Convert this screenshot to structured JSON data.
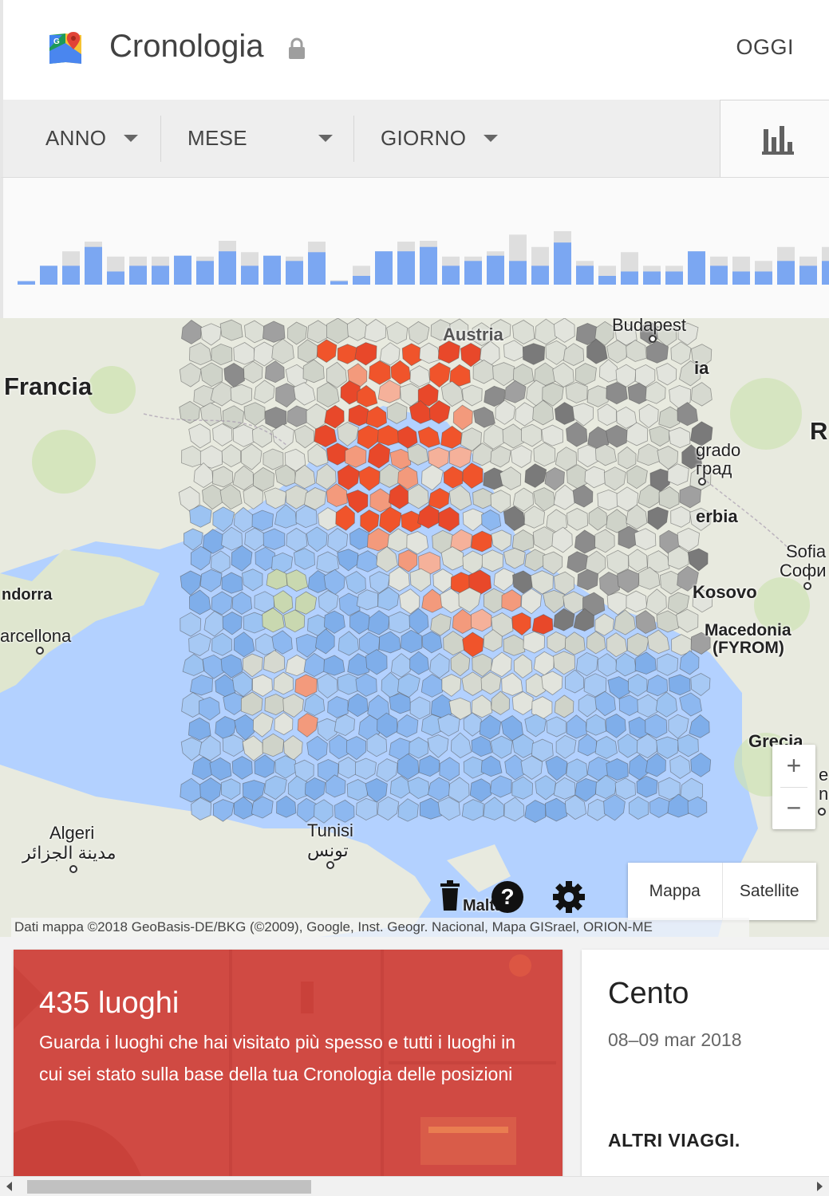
{
  "header": {
    "title": "Cronologia",
    "today_button": "OGGI",
    "logo_icon": "google-maps-icon",
    "lock_icon": "lock-icon"
  },
  "filters": {
    "year": "ANNO",
    "month": "MESE",
    "day": "GIORNO",
    "chart_icon": "bar-chart-icon"
  },
  "histogram": {
    "colors": {
      "primary": "#7ba7f2",
      "secondary": "#dedede"
    },
    "bars": [
      {
        "blue": 0.08,
        "gray": 0.08
      },
      {
        "blue": 0.43,
        "gray": 0.43
      },
      {
        "blue": 0.43,
        "gray": 0.76
      },
      {
        "blue": 0.86,
        "gray": 0.98
      },
      {
        "blue": 0.3,
        "gray": 0.64
      },
      {
        "blue": 0.43,
        "gray": 0.64
      },
      {
        "blue": 0.43,
        "gray": 0.64
      },
      {
        "blue": 0.66,
        "gray": 0.66
      },
      {
        "blue": 0.54,
        "gray": 0.64
      },
      {
        "blue": 0.76,
        "gray": 1.0
      },
      {
        "blue": 0.43,
        "gray": 0.74
      },
      {
        "blue": 0.66,
        "gray": 0.66
      },
      {
        "blue": 0.54,
        "gray": 0.64
      },
      {
        "blue": 0.74,
        "gray": 0.98
      },
      {
        "blue": 0.08,
        "gray": 0.1
      },
      {
        "blue": 0.2,
        "gray": 0.43
      },
      {
        "blue": 0.76,
        "gray": 0.76
      },
      {
        "blue": 0.76,
        "gray": 0.98
      },
      {
        "blue": 0.86,
        "gray": 1.0
      },
      {
        "blue": 0.43,
        "gray": 0.64
      },
      {
        "blue": 0.54,
        "gray": 0.64
      },
      {
        "blue": 0.66,
        "gray": 0.76
      },
      {
        "blue": 0.54,
        "gray": 1.14
      },
      {
        "blue": 0.43,
        "gray": 0.86
      },
      {
        "blue": 0.96,
        "gray": 1.22
      },
      {
        "blue": 0.43,
        "gray": 0.54
      },
      {
        "blue": 0.2,
        "gray": 0.43
      },
      {
        "blue": 0.3,
        "gray": 0.74
      },
      {
        "blue": 0.3,
        "gray": 0.43
      },
      {
        "blue": 0.3,
        "gray": 0.43
      },
      {
        "blue": 0.76,
        "gray": 0.76
      },
      {
        "blue": 0.43,
        "gray": 0.64
      },
      {
        "blue": 0.3,
        "gray": 0.64
      },
      {
        "blue": 0.3,
        "gray": 0.54
      },
      {
        "blue": 0.54,
        "gray": 0.86
      },
      {
        "blue": 0.43,
        "gray": 0.64
      },
      {
        "blue": 0.54,
        "gray": 0.86
      },
      {
        "blue": 0.3,
        "gray": 0.4
      }
    ]
  },
  "map": {
    "labels": {
      "austria": "Austria",
      "budapest": "Budapest",
      "francia": "Francia",
      "r_partial": "R",
      "ia_partial": "ia",
      "belgrado": "grado",
      "belgrado_cyr": "град",
      "serbia": "erbia",
      "sofia": "Sofia",
      "sofia_cyr": "Софи",
      "andorra": "ndorra",
      "barcellona": "arcellona",
      "kosovo": "Kosovo",
      "macedonia": "Macedonia",
      "fyrom": "(FYROM)",
      "grecia": "Grecia",
      "algeri": "Algeri",
      "algeri_ar": "مدينة الجزائر",
      "tunisi": "Tunisi",
      "tunisi_ar": "تونس",
      "malta": "Malta",
      "er_partial": "e",
      "in_partial": "n"
    },
    "zoom_in": "+",
    "zoom_out": "−",
    "map_type": {
      "map": "Mappa",
      "satellite": "Satellite"
    },
    "attribution": "Dati mappa ©2018 GeoBasis-DE/BKG (©2009), Google, Inst. Geogr. Nacional, Mapa GISrael, ORION-ME",
    "icons": {
      "delete": "trash-icon",
      "help": "help-icon",
      "settings": "gear-icon"
    },
    "colors": {
      "sea": "#b3d1ff",
      "land": "#e8eadf",
      "visited_high": "#f0542b",
      "visited_mid": "#f39a7c",
      "unvisited_sea": "#8db8f0",
      "unvisited_land": "#d6d9d0",
      "dark": "#8c8c8c"
    }
  },
  "places_card": {
    "count": "435 luoghi",
    "description": "Guarda i luoghi che hai visitato più spesso e tutti i luoghi in cui sei stato sulla base della tua Cronologia delle posizioni"
  },
  "trip_card": {
    "name": "Cento",
    "date": "08–09 mar 2018",
    "more": "ALTRI VIAGGI."
  }
}
